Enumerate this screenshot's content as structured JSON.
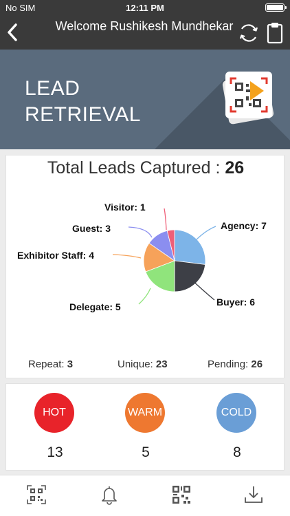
{
  "status_bar": {
    "carrier": "No SIM",
    "time": "12:11 PM"
  },
  "header": {
    "title": "Welcome Rushikesh Mundhekar"
  },
  "banner": {
    "line1": "LEAD",
    "line2": "RETRIEVAL"
  },
  "leads": {
    "title_label": "Total Leads Captured : ",
    "total": "26"
  },
  "chart_data": {
    "type": "pie",
    "total": 26,
    "slices": [
      {
        "label": "Agency",
        "value": 7,
        "color": "#7db4e8"
      },
      {
        "label": "Buyer",
        "value": 6,
        "color": "#3d3f46"
      },
      {
        "label": "Delegate",
        "value": 5,
        "color": "#90e47c"
      },
      {
        "label": "Exhibitor Staff",
        "value": 4,
        "color": "#f6a25a"
      },
      {
        "label": "Guest",
        "value": 3,
        "color": "#8b8ef0"
      },
      {
        "label": "Visitor",
        "value": 1,
        "color": "#ef5f78"
      }
    ]
  },
  "pie_labels": {
    "agency": "Agency: 7",
    "buyer": "Buyer: 6",
    "delegate": "Delegate: 5",
    "exhibitor": "Exhibitor Staff: 4",
    "guest": "Guest: 3",
    "visitor": "Visitor: 1"
  },
  "stats": {
    "repeat_label": "Repeat: ",
    "repeat": "3",
    "unique_label": "Unique: ",
    "unique": "23",
    "pending_label": "Pending: ",
    "pending": "26"
  },
  "temperature": [
    {
      "label": "HOT",
      "count": "13",
      "color": "#e8232a"
    },
    {
      "label": "WARM",
      "count": "5",
      "color": "#ee7830"
    },
    {
      "label": "COLD",
      "count": "8",
      "color": "#6a9ed6"
    }
  ],
  "tabs": [
    {
      "icon": "qr-scan-icon"
    },
    {
      "icon": "bell-icon"
    },
    {
      "icon": "qr-code-icon"
    },
    {
      "icon": "download-icon"
    }
  ]
}
